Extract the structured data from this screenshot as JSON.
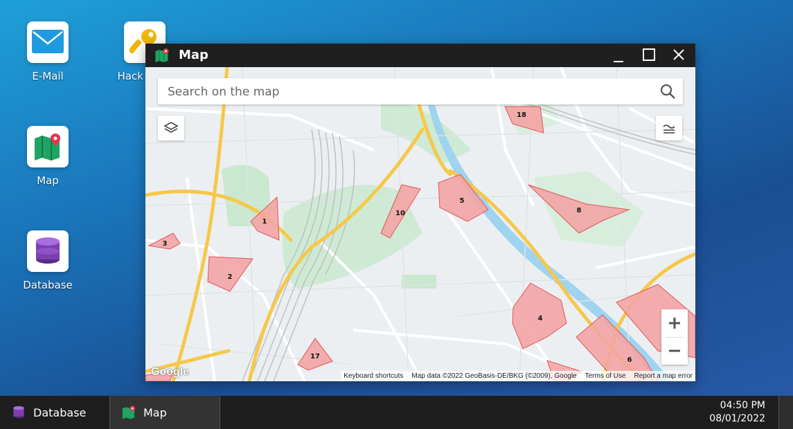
{
  "desktop": {
    "icons": [
      {
        "label": "E-Mail",
        "icon": "mail-icon"
      },
      {
        "label": "Hack Tools",
        "icon": "key-icon"
      },
      {
        "label": "Map",
        "icon": "map-icon"
      },
      {
        "label": "Database",
        "icon": "database-icon"
      }
    ]
  },
  "window": {
    "title": "Map",
    "controls": [
      "minimize-icon",
      "maximize-icon",
      "close-icon"
    ]
  },
  "map": {
    "search_placeholder": "Search on the map",
    "zones": [
      "1",
      "2",
      "3",
      "4",
      "5",
      "6",
      "8",
      "10",
      "17",
      "18"
    ],
    "zoom_in": "+",
    "zoom_out": "−",
    "logo": "Google",
    "attribution": {
      "shortcuts": "Keyboard shortcuts",
      "data": "Map data ©2022 GeoBasis-DE/BKG (©2009), Google",
      "terms": "Terms of Use",
      "report": "Report a map error"
    },
    "colors": {
      "zone_fill": "#f4a3a3",
      "zone_stroke": "#e05555",
      "water": "#9fd4f0",
      "park": "#c9e8cf",
      "highway": "#f6c84a"
    }
  },
  "taskbar": {
    "items": [
      {
        "label": "Database",
        "icon": "database-icon"
      },
      {
        "label": "Map",
        "icon": "map-icon"
      }
    ],
    "time": "04:50 PM",
    "date": "08/01/2022"
  }
}
